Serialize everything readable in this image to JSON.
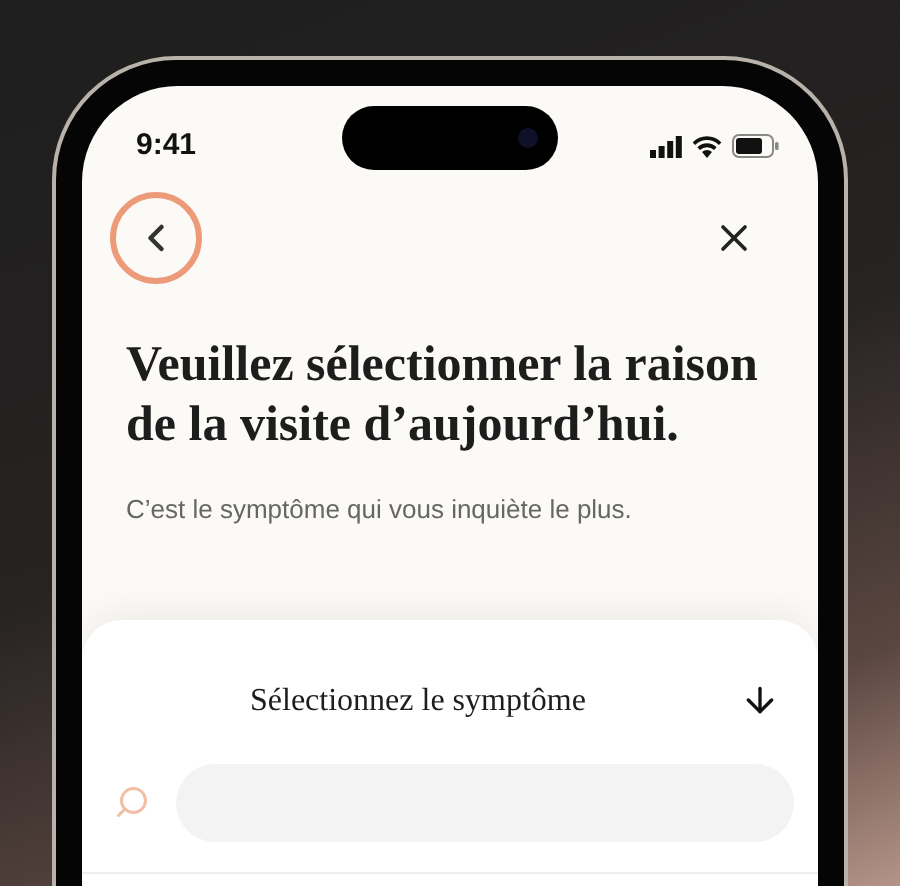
{
  "status_bar": {
    "time": "9:41"
  },
  "header": {
    "title": "Veuillez sélectionner la raison de la visite d’aujourd’hui.",
    "subtitle": "C’est le symptôme qui vous inquiète le plus."
  },
  "symptom_sheet": {
    "title": "Sélectionnez le symptôme"
  }
}
